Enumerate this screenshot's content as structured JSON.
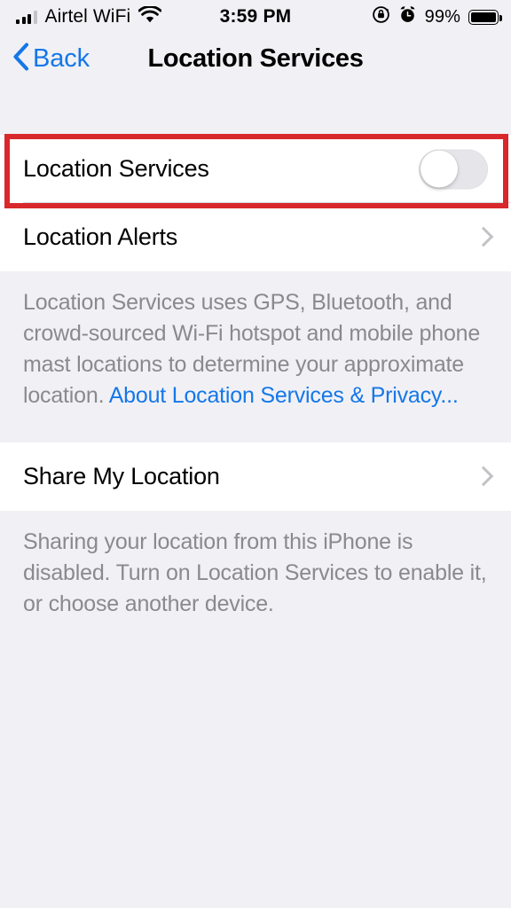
{
  "status_bar": {
    "carrier": "Airtel WiFi",
    "time": "3:59 PM",
    "battery_percent": "99%",
    "signal_bars_filled": 3,
    "signal_bars_total": 4,
    "icons": [
      "signal-bars-icon",
      "wifi-icon",
      "rotation-lock-icon",
      "alarm-clock-icon",
      "battery-icon"
    ]
  },
  "nav": {
    "back_label": "Back",
    "title": "Location Services"
  },
  "sections": {
    "main_toggle": {
      "label": "Location Services",
      "toggle_state": "off"
    },
    "alerts_row": {
      "label": "Location Alerts"
    },
    "footer_one": {
      "text": "Location Services uses GPS, Bluetooth, and crowd-sourced Wi-Fi hotspot and mobile phone mast locations to determine your approximate location. ",
      "link": "About Location Services & Privacy..."
    },
    "share_row": {
      "label": "Share My Location"
    },
    "footer_two": {
      "text": "Sharing your location from this iPhone is disabled. Turn on Location Services to enable it, or choose another device."
    }
  },
  "annotation": {
    "type": "highlight-rectangle",
    "color": "#d8282c",
    "target": "Location Services toggle row"
  },
  "colors": {
    "accent_blue": "#1577e8",
    "background_gray": "#f1f1f5",
    "row_white": "#ffffff",
    "secondary_text": "#8a8a8e",
    "annotation_red": "#d8282c",
    "toggle_off_track": "#e6e6ea"
  }
}
